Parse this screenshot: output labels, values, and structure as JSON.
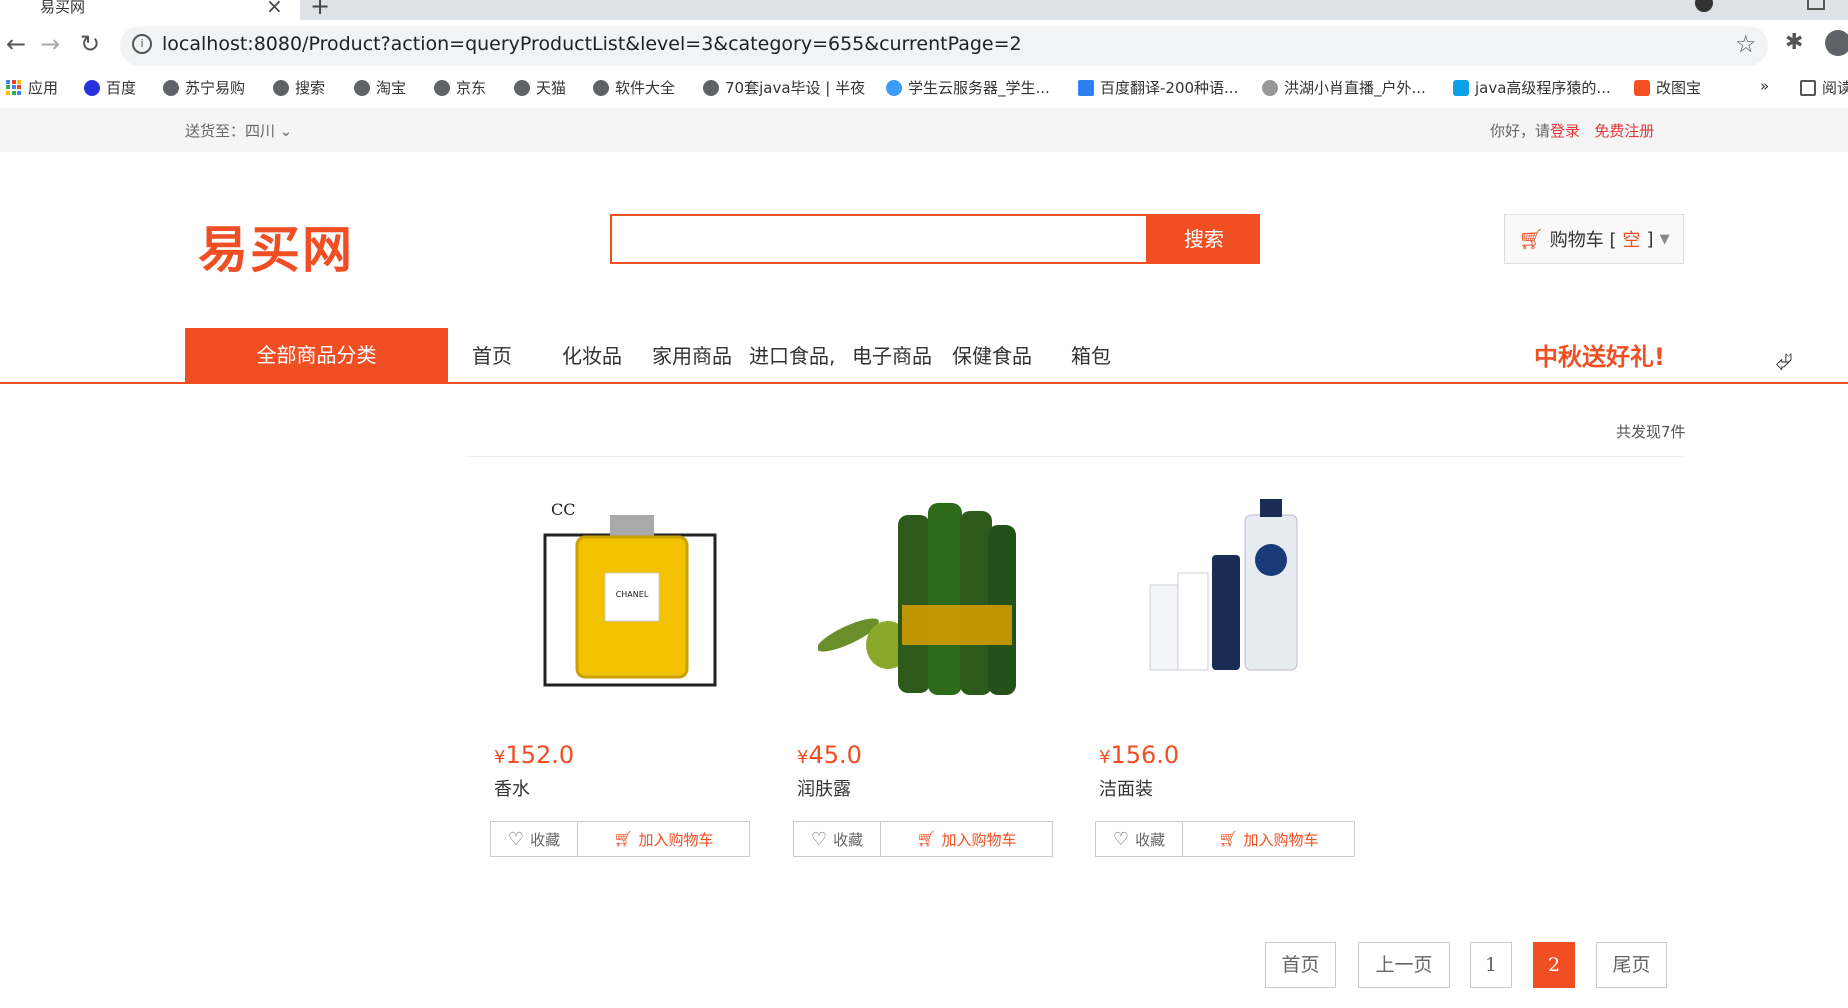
{
  "browser": {
    "tab_title": "易买网",
    "url": "localhost:8080/Product?action=queryProductList&level=3&category=655&currentPage=2",
    "bookmarks": [
      "应用",
      "百度",
      "苏宁易购",
      "搜索",
      "淘宝",
      "京东",
      "天猫",
      "软件大全",
      "70套java毕设 | 半夜",
      "学生云服务器_学生...",
      "百度翻译-200种语...",
      "洪湖小肖直播_户外...",
      "java高级程序猿的...",
      "改图宝",
      "»",
      "阅读"
    ]
  },
  "topbar": {
    "ship_label": "送货至：四川",
    "greeting": "你好，请",
    "login": "登录",
    "register": "免费注册"
  },
  "header": {
    "logo": "易买网",
    "search_placeholder": "",
    "search_button": "搜索",
    "cart_label": "购物车 [",
    "cart_empty": "空",
    "cart_close": "]"
  },
  "nav": {
    "all_categories": "全部商品分类",
    "items": [
      "首页",
      "化妆品",
      "家用商品",
      "进口食品,",
      "电子商品",
      "保健食品",
      "箱包"
    ],
    "promo": "中秋送好礼!"
  },
  "listing": {
    "found": "共发现7件",
    "products": [
      {
        "price_symbol": "¥",
        "price": "152.0",
        "name": "香水",
        "fav": "收藏",
        "add": "加入购物车"
      },
      {
        "price_symbol": "¥",
        "price": "45.0",
        "name": "润肤露",
        "fav": "收藏",
        "add": "加入购物车"
      },
      {
        "price_symbol": "¥",
        "price": "156.0",
        "name": "洁面装",
        "fav": "收藏",
        "add": "加入购物车"
      }
    ]
  },
  "pagination": {
    "first": "首页",
    "prev": "上一页",
    "pages": [
      "1",
      "2"
    ],
    "current": "2",
    "last": "尾页"
  },
  "colors": {
    "accent": "#f04e23"
  }
}
